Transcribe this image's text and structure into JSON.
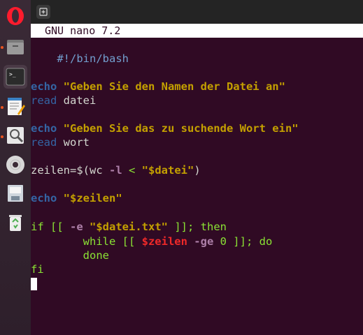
{
  "nano": {
    "title": "GNU nano 7.2"
  },
  "code": {
    "l1": "#!/bin/bash",
    "l4_kw": "echo",
    "l4_str": "\"Geben Sie den Namen der Datei an\"",
    "l5_kw": "read",
    "l5_rest": " datei",
    "l7_kw": "echo",
    "l7_str": "\"Geben Sie das zu suchende Wort ein\"",
    "l8_kw": "read",
    "l8_rest": " wort",
    "l10_a": "zeilen=$(wc ",
    "l10_opt": "-l",
    "l10_b": " < ",
    "l10_str": "\"$datei\"",
    "l10_c": ")",
    "l12_kw": "echo",
    "l12_str": "\"$zeilen\"",
    "l14_a": "if [[ ",
    "l14_opt": "-e",
    "l14_str": "\"$datei.txt\"",
    "l14_b": " ]]; then",
    "l15_a": "        while [[ ",
    "l15_var": "$zeilen",
    "l15_opt": " -ge",
    "l15_b": " 0 ]]; do",
    "l16": "        done",
    "l17": "fi"
  }
}
